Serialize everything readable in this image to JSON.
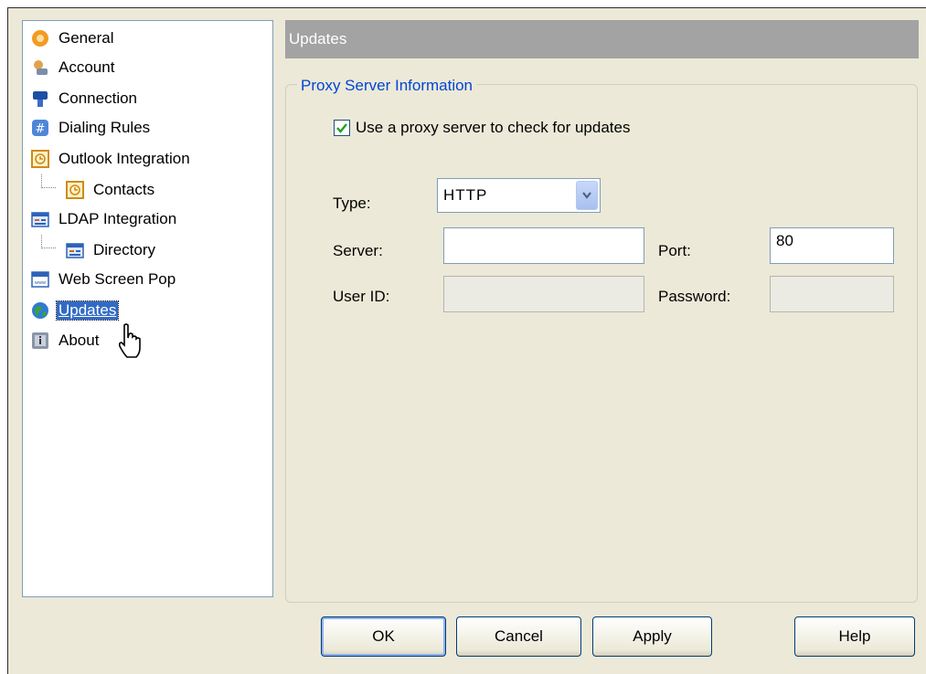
{
  "tree": {
    "items": [
      {
        "label": "General",
        "icon": "general-icon"
      },
      {
        "label": "Account",
        "icon": "account-icon"
      },
      {
        "label": "Connection",
        "icon": "connection-icon"
      },
      {
        "label": "Dialing Rules",
        "icon": "dialing-rules-icon"
      },
      {
        "label": "Outlook Integration",
        "icon": "outlook-icon"
      },
      {
        "label": "Contacts",
        "icon": "contacts-icon"
      },
      {
        "label": "LDAP Integration",
        "icon": "ldap-icon"
      },
      {
        "label": "Directory",
        "icon": "directory-icon"
      },
      {
        "label": "Web Screen Pop",
        "icon": "web-screen-pop-icon"
      },
      {
        "label": "Updates",
        "icon": "updates-icon"
      },
      {
        "label": "About",
        "icon": "about-icon"
      }
    ],
    "selected": "Updates"
  },
  "section": {
    "title": "Updates"
  },
  "proxy": {
    "group_title": "Proxy Server Information",
    "use_proxy_label": "Use a proxy server to check for updates",
    "use_proxy_checked": true,
    "type_label": "Type:",
    "type_value": "HTTP",
    "server_label": "Server:",
    "server_value": "",
    "port_label": "Port:",
    "port_value": "80",
    "userid_label": "User ID:",
    "userid_value": "",
    "password_label": "Password:",
    "password_value": ""
  },
  "buttons": {
    "ok": "OK",
    "cancel": "Cancel",
    "apply": "Apply",
    "help": "Help"
  },
  "colors": {
    "dialog_bg": "#ece9d8",
    "header_bg": "#a3a3a3",
    "group_title": "#0046d5",
    "selection": "#316ac5"
  }
}
